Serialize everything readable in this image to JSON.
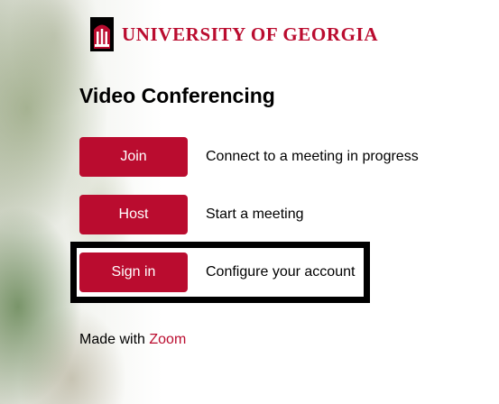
{
  "brand": {
    "name": "UNIVERSITY OF GEORGIA",
    "logo_icon": "arch-icon",
    "accent_color": "#ba0c2f"
  },
  "title": "Video Conferencing",
  "actions": [
    {
      "label": "Join",
      "description": "Connect to a meeting in progress"
    },
    {
      "label": "Host",
      "description": "Start a meeting"
    },
    {
      "label": "Sign in",
      "description": "Configure your account"
    }
  ],
  "footer": {
    "prefix": "Made with",
    "link": "Zoom"
  }
}
